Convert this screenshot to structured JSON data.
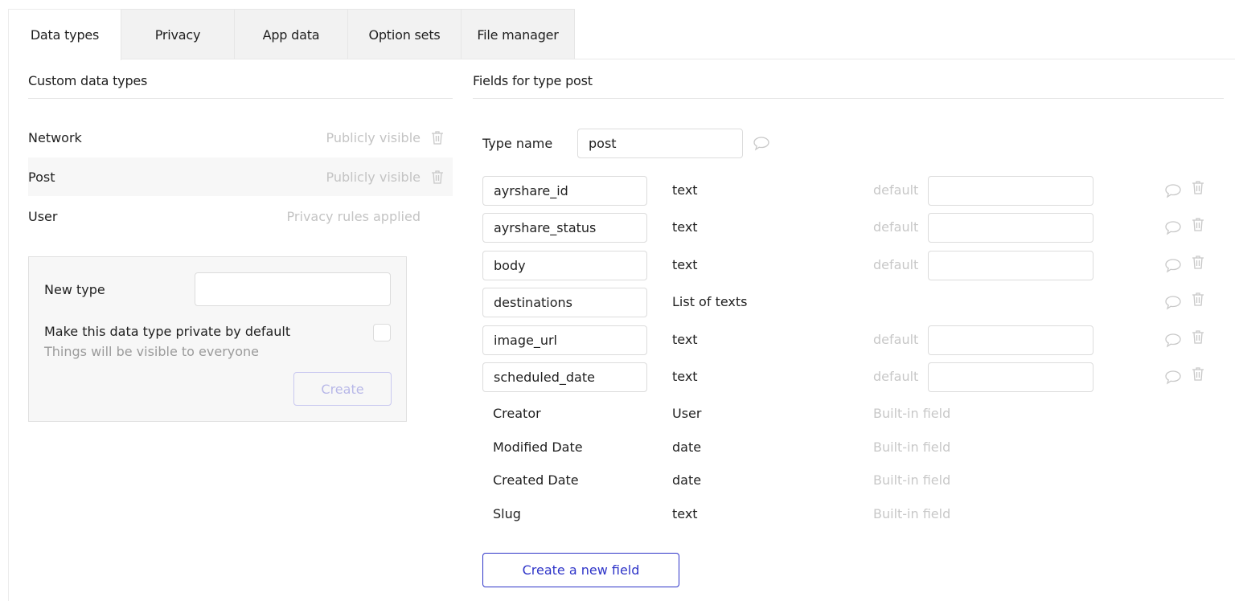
{
  "tabs": [
    {
      "label": "Data types",
      "active": true
    },
    {
      "label": "Privacy",
      "active": false
    },
    {
      "label": "App data",
      "active": false
    },
    {
      "label": "Option sets",
      "active": false
    },
    {
      "label": "File manager",
      "active": false
    }
  ],
  "left_panel": {
    "title": "Custom data types",
    "types": [
      {
        "name": "Network",
        "privacy": "Publicly visible",
        "deletable": true,
        "selected": false
      },
      {
        "name": "Post",
        "privacy": "Publicly visible",
        "deletable": true,
        "selected": true
      },
      {
        "name": "User",
        "privacy": "Privacy rules applied",
        "deletable": false,
        "selected": false
      }
    ],
    "new_type": {
      "label": "New type",
      "value": "",
      "private_label": "Make this data type private by default",
      "private_sublabel": "Things will be visible to everyone",
      "private_checked": false,
      "create_label": "Create"
    }
  },
  "right_panel": {
    "title": "Fields for type post",
    "type_name_label": "Type name",
    "type_name_value": "post",
    "default_label": "default",
    "fields": [
      {
        "name": "ayrshare_id",
        "type": "text",
        "has_default": true,
        "default": ""
      },
      {
        "name": "ayrshare_status",
        "type": "text",
        "has_default": true,
        "default": ""
      },
      {
        "name": "body",
        "type": "text",
        "has_default": true,
        "default": ""
      },
      {
        "name": "destinations",
        "type": "List of texts",
        "has_default": false,
        "default": ""
      },
      {
        "name": "image_url",
        "type": "text",
        "has_default": true,
        "default": ""
      },
      {
        "name": "scheduled_date",
        "type": "text",
        "has_default": true,
        "default": ""
      }
    ],
    "builtin_fields": [
      {
        "name": "Creator",
        "type": "User",
        "tag": "Built-in field"
      },
      {
        "name": "Modified Date",
        "type": "date",
        "tag": "Built-in field"
      },
      {
        "name": "Created Date",
        "type": "date",
        "tag": "Built-in field"
      },
      {
        "name": "Slug",
        "type": "text",
        "tag": "Built-in field"
      }
    ],
    "create_field_label": "Create a new field"
  },
  "icons": {
    "comment": "speech-bubble-icon",
    "trash": "trash-icon"
  },
  "colors": {
    "accent": "#2e34c8",
    "muted_text": "#c8c8c8",
    "disabled_button_border": "#c9c8f0"
  }
}
